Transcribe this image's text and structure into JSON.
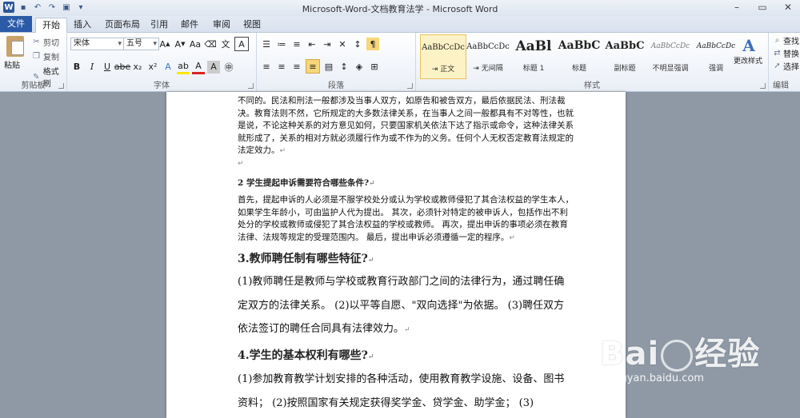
{
  "window": {
    "title": "Microsoft-Word-文档教育法学  -  Microsoft Word",
    "controls": [
      "–",
      "▭",
      "✕"
    ]
  },
  "tabs": [
    "文件",
    "开始",
    "插入",
    "页面布局",
    "引用",
    "邮件",
    "审阅",
    "视图"
  ],
  "active_tab": "开始",
  "clipboard": {
    "paste": "粘贴",
    "cut": "剪切",
    "copy": "复制",
    "format_painter": "格式刷",
    "label": "剪贴板"
  },
  "font": {
    "name": "宋体",
    "size": "五号",
    "label": "字体"
  },
  "paragraph": {
    "label": "段落"
  },
  "styles": {
    "label": "样式",
    "items": [
      {
        "preview": "AaBbCcDc",
        "name": "⇥ 正文"
      },
      {
        "preview": "AaBbCcDc",
        "name": "⇥ 无间隔"
      },
      {
        "preview": "AaBl",
        "name": "标题 1"
      },
      {
        "preview": "AaBbC",
        "name": "标题"
      },
      {
        "preview": "AaBbC",
        "name": "副标题"
      },
      {
        "preview": "AaBbCcDc",
        "name": "不明显强调"
      },
      {
        "preview": "AaBbCcDc",
        "name": "强调"
      }
    ],
    "change_styles": "更改样式"
  },
  "editing": {
    "find": "查找",
    "replace": "替换",
    "select": "选择",
    "label": "编辑"
  },
  "document": {
    "p1": "不同的。民法和刑法一般都涉及当事人双方，如原告和被告双方，最后依据民法、刑法裁决。教育法则不然，它所规定的大多数法律关系，在当事人之间一般都具有不对等性，也就是说，不论这种关系的对方意见如何，只要国家机关依法下达了指示或命令，这种法律关系就形成了，关系的相对方就必须履行作为或不作为的义务。任何个人无权否定教育法规定的法定效力。",
    "h2": "2 学生提起申诉需要符合哪些条件?",
    "p2": "首先，提起申诉的人必须是不服学校处分或认为学校或教师侵犯了其合法权益的学生本人，如果学生年龄小，可由监护人代为提出。 其次，必须针对特定的被申诉人，包括作出不利处分的学校或教师或侵犯了其合法权益的学校或教师。 再次，提出申诉的事项必须在教育法律、法规等规定的受理范围内。 最后，提出申诉必须遵循一定的程序。",
    "h3": "3.教师聘任制有哪些特征?",
    "p3": "(1)教师聘任是教师与学校或教育行政部门之间的法律行为，通过聘任确定双方的法律关系。 (2)以平等自愿、\"双向选择\"为依据。 (3)聘任双方依法签订的聘任合同具有法律效力。",
    "h4": "4.学生的基本权利有哪些?",
    "p4": "(1)参加教育教学计划安排的各种活动，使用教育教学设施、设备、图书资料； (2)按照国家有关规定获得奖学金、贷学金、助学金； (3)"
  },
  "watermark": {
    "brand_left": "Bai",
    "brand_right": "经验",
    "url": "jingyan.baidu.com"
  },
  "colors": {
    "file_tab": "#2a5aa8",
    "doc_bg": "#8f99a6",
    "selected_style": "#fdf2c6"
  }
}
